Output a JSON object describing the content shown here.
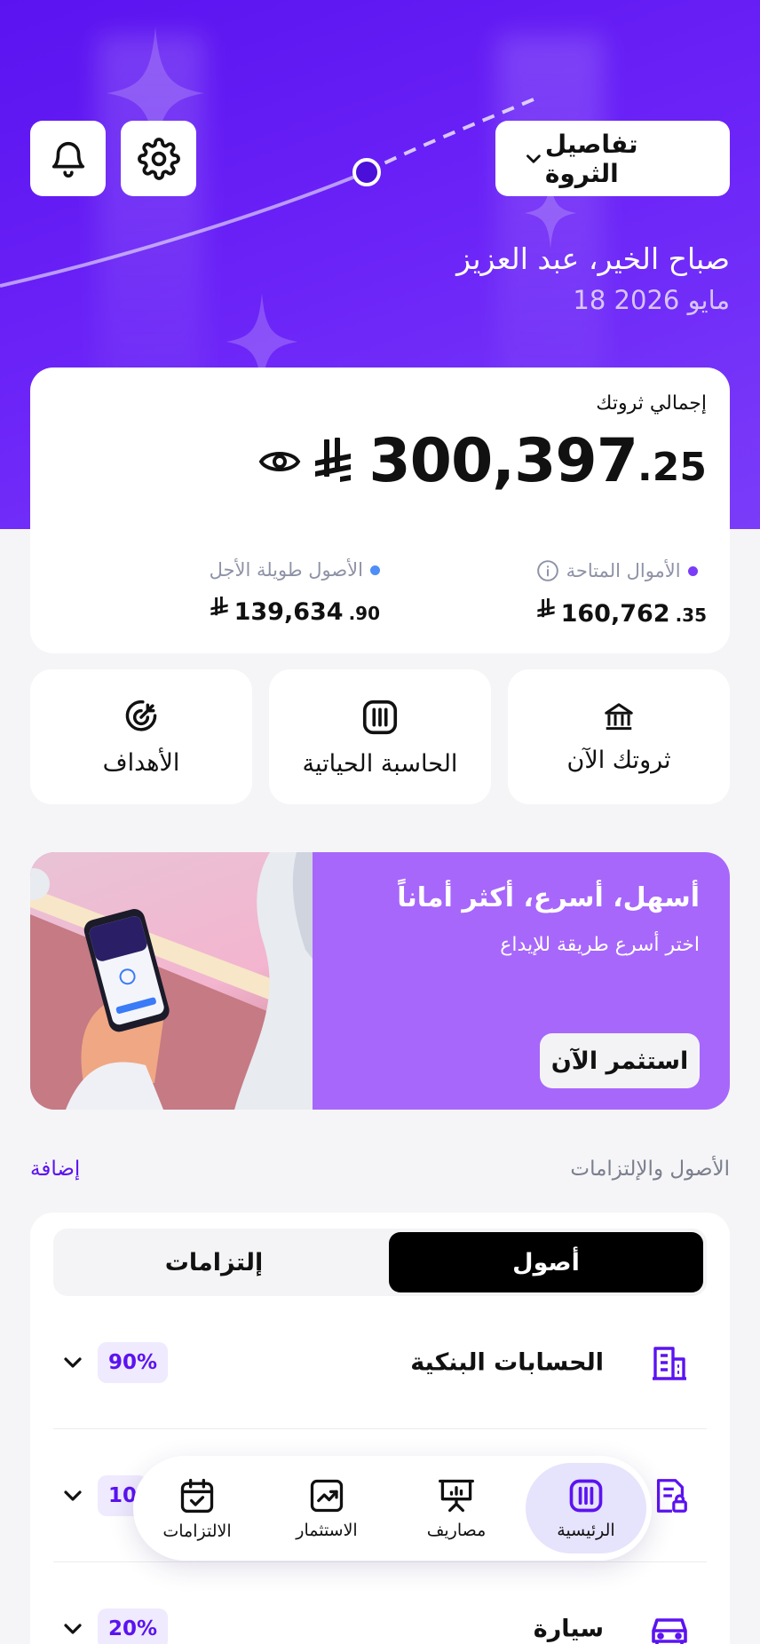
{
  "header": {
    "wealth_dropdown_label": "تفاصيل الثروة",
    "greeting": "صباح الخير، عبد العزيز",
    "date": "18 مايو 2026"
  },
  "total": {
    "label": "إجمالي ثروتك",
    "amount_int": "300,397",
    "amount_dec": ".25",
    "available": {
      "label": "الأموال المتاحة",
      "int": "160,762",
      "dec": ".35",
      "dot_color": "#7a3cf7"
    },
    "long_term": {
      "label": "الأصول طويلة الأجل",
      "int": "139,634",
      "dec": ".90",
      "dot_color": "#4f8ef7"
    }
  },
  "quick_actions": [
    {
      "label": "ثروتك الآن",
      "icon": "bank-icon"
    },
    {
      "label": "الحاسبة الحياتية",
      "icon": "calculator-icon"
    },
    {
      "label": "الأهداف",
      "icon": "target-icon"
    }
  ],
  "promo": {
    "title": "أسهل، أسرع، أكثر أماناً",
    "subtitle": "اختر  أسرع طريقة للإيداع",
    "button": "استثمر الآن"
  },
  "assets_section": {
    "title": "الأصول والإلتزامات",
    "add": "إضافة",
    "tabs": [
      "أصول",
      "إلتزامات"
    ],
    "rows": [
      {
        "name": "الحسابات البنكية",
        "percent": "90%",
        "icon": "building-icon"
      },
      {
        "name": "",
        "percent": "10",
        "icon": "document-lock-icon"
      },
      {
        "name": "سيارة",
        "percent": "20%",
        "icon": "car-icon"
      }
    ]
  },
  "bottom_nav": [
    {
      "label": "الرئيسية",
      "icon": "home-icon",
      "active": true
    },
    {
      "label": "مصاريف",
      "icon": "expenses-icon",
      "active": false
    },
    {
      "label": "الاستثمار",
      "icon": "investment-icon",
      "active": false
    },
    {
      "label": "الالتزامات",
      "icon": "calendar-check-icon",
      "active": false
    }
  ],
  "colors": {
    "brand": "#5b13f0",
    "promo_bg": "#a767fb",
    "page_bg": "#f5f5f7"
  }
}
